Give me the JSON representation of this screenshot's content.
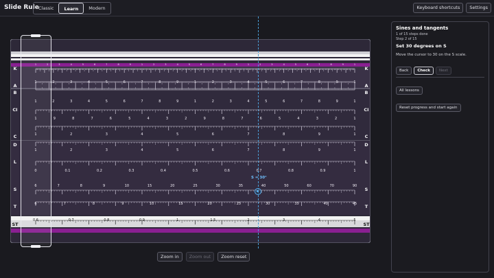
{
  "app": {
    "title": "Slide Rule"
  },
  "modes": [
    {
      "label": "Classic",
      "active": false
    },
    {
      "label": "Learn",
      "active": true
    },
    {
      "label": "Modern",
      "active": false
    }
  ],
  "toolbar": {
    "shortcuts_label": "Keyboard shortcuts",
    "settings_label": "Settings"
  },
  "cursor": {
    "readout": "S = 30°"
  },
  "zoom": {
    "in_label": "Zoom in",
    "out_label": "Zoom out",
    "reset_label": "Zoom reset",
    "out_disabled": true
  },
  "lesson": {
    "title": "Sines and tangents",
    "progress": "1 of 15 steps done",
    "step_counter": "Step 2 of 15",
    "step_title": "Set 30 degrees on S",
    "instruction": "Move the cursor to 30 on the S scale.",
    "back_label": "Back",
    "check_label": "Check",
    "next_label": "Next",
    "next_disabled": true,
    "all_lessons_label": "All lessons",
    "reset_label": "Reset progress and start again"
  },
  "scales": {
    "K": {
      "label": "K",
      "nums": [
        "1",
        "2",
        "3",
        "4",
        "5",
        "6",
        "7",
        "8",
        "9",
        "1",
        "2",
        "3",
        "4",
        "5",
        "6",
        "7",
        "8",
        "9",
        "1",
        "2",
        "3",
        "4",
        "5",
        "6",
        "7",
        "8",
        "9",
        "1"
      ]
    },
    "A": {
      "label": "A",
      "nums": [
        "1",
        "2",
        "3",
        "4",
        "5",
        "6",
        "7",
        "8",
        "9",
        "1",
        "2",
        "3",
        "4",
        "5",
        "6",
        "7",
        "8",
        "9",
        "1"
      ]
    },
    "B": {
      "label": "B",
      "nums": [
        "1",
        "2",
        "3",
        "4",
        "5",
        "6",
        "7",
        "8",
        "9",
        "1",
        "2",
        "3",
        "4",
        "5",
        "6",
        "7",
        "8",
        "9",
        "1"
      ]
    },
    "CI": {
      "label": "CI",
      "nums": [
        "1",
        "9",
        "8",
        "7",
        "6",
        "5",
        "4",
        "3",
        "2",
        "9",
        "8",
        "7",
        "6",
        "5",
        "4",
        "3",
        "2",
        "1"
      ]
    },
    "C": {
      "label": "C",
      "nums": [
        "1",
        "2",
        "3",
        "4",
        "5",
        "6",
        "7",
        "8",
        "9",
        "1"
      ]
    },
    "D": {
      "label": "D",
      "nums": [
        "1",
        "2",
        "3",
        "4",
        "5",
        "6",
        "7",
        "8",
        "9",
        "1"
      ]
    },
    "L": {
      "label": "L",
      "nums": [
        "0",
        "0.1",
        "0.2",
        "0.3",
        "0.4",
        "0.5",
        "0.6",
        "0.7",
        "0.8",
        "0.9",
        "1"
      ]
    },
    "S": {
      "label": "S",
      "nums": [
        "6",
        "7",
        "8",
        "9",
        "10",
        "15",
        "20",
        "25",
        "30",
        "35",
        "40",
        "50",
        "60",
        "70",
        "90"
      ]
    },
    "T": {
      "label": "T",
      "nums": [
        "6",
        "7",
        "8",
        "9",
        "10",
        "15",
        "20",
        "25",
        "30",
        "35",
        "40",
        "45"
      ]
    },
    "ST": {
      "label": "ST",
      "nums": [
        "0.6",
        "0.7",
        "0.8",
        "0.9",
        "1",
        "1.5",
        "2",
        "3",
        "4",
        "5"
      ]
    }
  }
}
